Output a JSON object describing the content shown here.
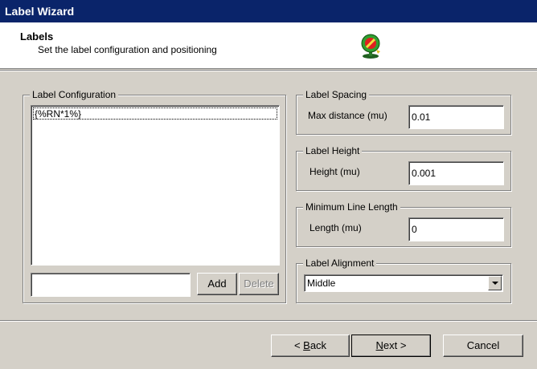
{
  "window": {
    "title": "Label Wizard"
  },
  "header": {
    "title": "Labels",
    "subtitle": "Set the label configuration and positioning",
    "icon": "globe-label-icon"
  },
  "label_configuration": {
    "legend": "Label Configuration",
    "items": [
      "{%RN*1%}"
    ],
    "new_item_value": "",
    "add_label": "Add",
    "delete_label": "Delete"
  },
  "label_spacing": {
    "legend": "Label Spacing",
    "field_label": "Max distance (mu)",
    "value": "0.01"
  },
  "label_height": {
    "legend": "Label Height",
    "field_label": "Height (mu)",
    "value": "0.001"
  },
  "min_line_length": {
    "legend": "Minimum Line Length",
    "field_label": "Length (mu)",
    "value": "0"
  },
  "label_alignment": {
    "legend": "Label Alignment",
    "selected": "Middle"
  },
  "footer": {
    "back_prefix": "< ",
    "back_mnemonic": "B",
    "back_rest": "ack",
    "next_mnemonic": "N",
    "next_rest": "ext >",
    "cancel_label": "Cancel"
  }
}
